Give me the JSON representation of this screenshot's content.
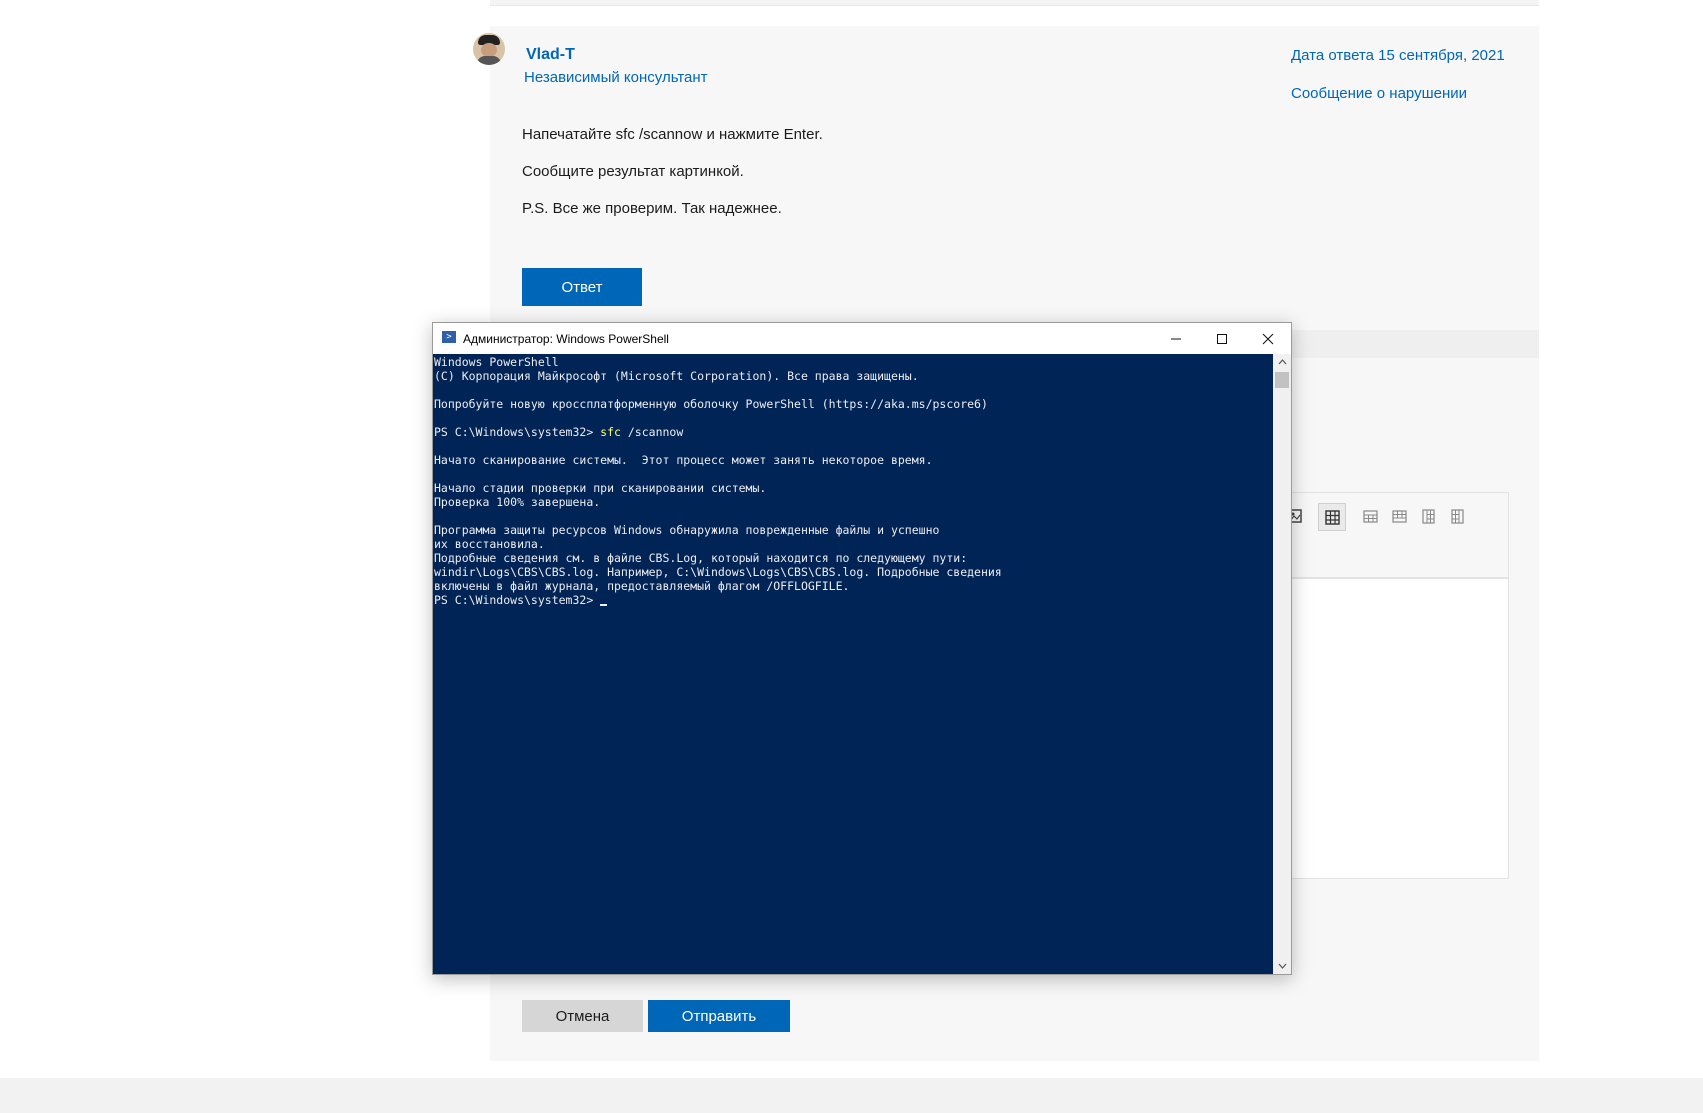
{
  "post": {
    "author_name": "Vlad-T",
    "author_role": "Независимый консультант",
    "reply_date": "Дата ответа 15 сентября, 2021",
    "report_link": "Сообщение о нарушении",
    "lines": [
      "Напечатайте sfc /scannow и нажмите Enter.",
      "Сообщите результат картинкой.",
      "P.S. Все же проверим. Так надежнее."
    ],
    "reply_button": "Ответ"
  },
  "editor": {
    "cancel_button": "Отмена",
    "submit_button": "Отправить",
    "toolbar_icons": [
      "image-icon",
      "table-icon",
      "table-row-above-icon",
      "table-row-below-icon",
      "table-col-left-icon",
      "table-col-right-icon"
    ]
  },
  "powershell": {
    "title": "Администратор: Windows PowerShell",
    "app_icon": ">",
    "console": {
      "line1": "Windows PowerShell",
      "line2": "(C) Корпорация Майкрософт (Microsoft Corporation). Все права защищены.",
      "line3": "Попробуйте новую кроссплатформенную оболочку PowerShell (https://aka.ms/pscore6)",
      "prompt1": "PS C:\\Windows\\system32> ",
      "command": "sfc",
      "command_args": " /scannow",
      "line5": "Начато сканирование системы.  Этот процесс может занять некоторое время.",
      "line6": "Начало стадии проверки при сканировании системы.",
      "line7": "Проверка 100% завершена.",
      "line8": "Программа защиты ресурсов Windows обнаружила поврежденные файлы и успешно",
      "line9": "их восстановила.",
      "line10": "Подробные сведения см. в файле CBS.Log, который находится по следующему пути:",
      "line11": "windir\\Logs\\CBS\\CBS.log. Например, C:\\Windows\\Logs\\CBS\\CBS.log. Подробные сведения",
      "line12": "включены в файл журнала, предоставляемый флагом /OFFLOGFILE.",
      "prompt2": "PS C:\\Windows\\system32> "
    }
  },
  "colors": {
    "accent": "#0067b8",
    "console_bg": "#012456",
    "console_text": "#eeedf0",
    "console_command": "#ffff66"
  }
}
